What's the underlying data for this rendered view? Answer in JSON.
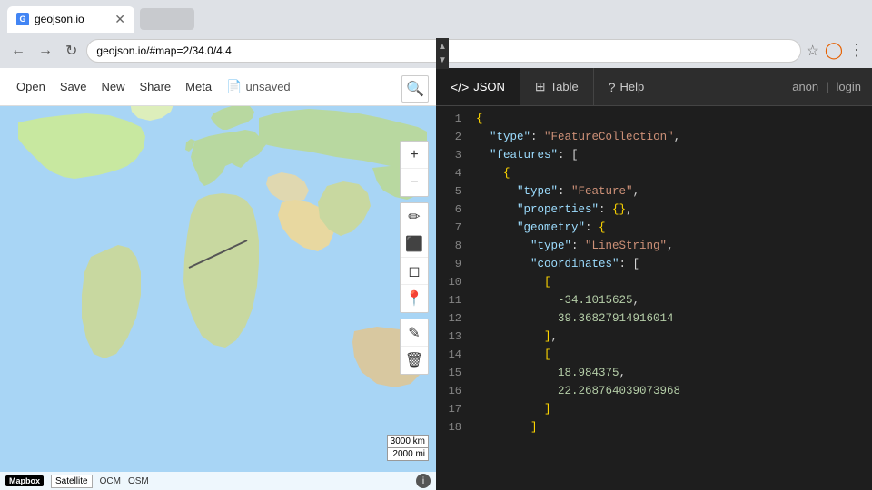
{
  "browser": {
    "tab_title": "geojson.io",
    "tab_url": "geojson.io/#map=2/34.0/4.4",
    "favicon": "G"
  },
  "toolbar": {
    "open_label": "Open",
    "save_label": "Save",
    "new_label": "New",
    "share_label": "Share",
    "meta_label": "Meta",
    "unsaved_label": "unsaved"
  },
  "panel": {
    "json_tab_label": "JSON",
    "table_tab_label": "Table",
    "help_tab_label": "Help",
    "anon_label": "anon",
    "login_label": "login"
  },
  "json_lines": [
    {
      "num": 1,
      "tokens": [
        {
          "t": "{",
          "c": "json-brace"
        }
      ]
    },
    {
      "num": 2,
      "tokens": [
        {
          "t": "  ",
          "c": ""
        },
        {
          "t": "\"type\"",
          "c": "json-key"
        },
        {
          "t": ": ",
          "c": "json-punct"
        },
        {
          "t": "\"FeatureCollection\"",
          "c": "json-string"
        },
        {
          "t": ",",
          "c": "json-punct"
        }
      ]
    },
    {
      "num": 3,
      "tokens": [
        {
          "t": "  ",
          "c": ""
        },
        {
          "t": "\"features\"",
          "c": "json-key"
        },
        {
          "t": ": [",
          "c": "json-punct"
        }
      ]
    },
    {
      "num": 4,
      "tokens": [
        {
          "t": "    ",
          "c": ""
        },
        {
          "t": "{",
          "c": "json-brace"
        }
      ]
    },
    {
      "num": 5,
      "tokens": [
        {
          "t": "      ",
          "c": ""
        },
        {
          "t": "\"type\"",
          "c": "json-key"
        },
        {
          "t": ": ",
          "c": "json-punct"
        },
        {
          "t": "\"Feature\"",
          "c": "json-string"
        },
        {
          "t": ",",
          "c": "json-punct"
        }
      ]
    },
    {
      "num": 6,
      "tokens": [
        {
          "t": "      ",
          "c": ""
        },
        {
          "t": "\"properties\"",
          "c": "json-key"
        },
        {
          "t": ": ",
          "c": "json-punct"
        },
        {
          "t": "{}",
          "c": "json-brace"
        },
        {
          "t": ",",
          "c": "json-punct"
        }
      ]
    },
    {
      "num": 7,
      "tokens": [
        {
          "t": "      ",
          "c": ""
        },
        {
          "t": "\"geometry\"",
          "c": "json-key"
        },
        {
          "t": ": ",
          "c": "json-punct"
        },
        {
          "t": "{",
          "c": "json-brace"
        }
      ]
    },
    {
      "num": 8,
      "tokens": [
        {
          "t": "        ",
          "c": ""
        },
        {
          "t": "\"type\"",
          "c": "json-key"
        },
        {
          "t": ": ",
          "c": "json-punct"
        },
        {
          "t": "\"LineString\"",
          "c": "json-string"
        },
        {
          "t": ",",
          "c": "json-punct"
        }
      ]
    },
    {
      "num": 9,
      "tokens": [
        {
          "t": "        ",
          "c": ""
        },
        {
          "t": "\"coordinates\"",
          "c": "json-key"
        },
        {
          "t": ": [",
          "c": "json-punct"
        }
      ]
    },
    {
      "num": 10,
      "tokens": [
        {
          "t": "          ",
          "c": ""
        },
        {
          "t": "[",
          "c": "json-brace"
        }
      ]
    },
    {
      "num": 11,
      "tokens": [
        {
          "t": "            ",
          "c": ""
        },
        {
          "t": "-34.1015625",
          "c": "json-number"
        },
        {
          "t": ",",
          "c": "json-punct"
        }
      ]
    },
    {
      "num": 12,
      "tokens": [
        {
          "t": "            ",
          "c": ""
        },
        {
          "t": "39.36827914916014",
          "c": "json-number"
        }
      ]
    },
    {
      "num": 13,
      "tokens": [
        {
          "t": "          ",
          "c": ""
        },
        {
          "t": "]",
          "c": "json-brace"
        },
        {
          "t": ",",
          "c": "json-punct"
        }
      ]
    },
    {
      "num": 14,
      "tokens": [
        {
          "t": "          ",
          "c": ""
        },
        {
          "t": "[",
          "c": "json-brace"
        }
      ]
    },
    {
      "num": 15,
      "tokens": [
        {
          "t": "            ",
          "c": ""
        },
        {
          "t": "18.984375",
          "c": "json-number"
        },
        {
          "t": ",",
          "c": "json-punct"
        }
      ]
    },
    {
      "num": 16,
      "tokens": [
        {
          "t": "            ",
          "c": ""
        },
        {
          "t": "22.268764039073968",
          "c": "json-number"
        }
      ]
    },
    {
      "num": 17,
      "tokens": [
        {
          "t": "          ",
          "c": ""
        },
        {
          "t": "]",
          "c": "json-brace"
        }
      ]
    },
    {
      "num": 18,
      "tokens": [
        {
          "t": "        ",
          "c": ""
        },
        {
          "t": "]",
          "c": "json-brace"
        }
      ]
    }
  ],
  "map": {
    "scale_km": "3000 km",
    "scale_mi": "2000 mi",
    "logo": "Mapbox",
    "satellite_btn": "Satellite",
    "ocm1": "OCM",
    "osm": "OSM"
  },
  "icons": {
    "search": "🔍",
    "zoom_in": "+",
    "zoom_out": "−",
    "pencil": "✏",
    "square": "⬛",
    "diamond": "⬟",
    "pin": "📍",
    "edit": "✎",
    "trash": "🗑",
    "info": "i",
    "back": "←",
    "forward": "→",
    "reload": "↻",
    "star": "☆",
    "menu": "⋮",
    "scroll_up": "▲",
    "scroll_down": "▼",
    "unsaved_icon": "📄"
  }
}
